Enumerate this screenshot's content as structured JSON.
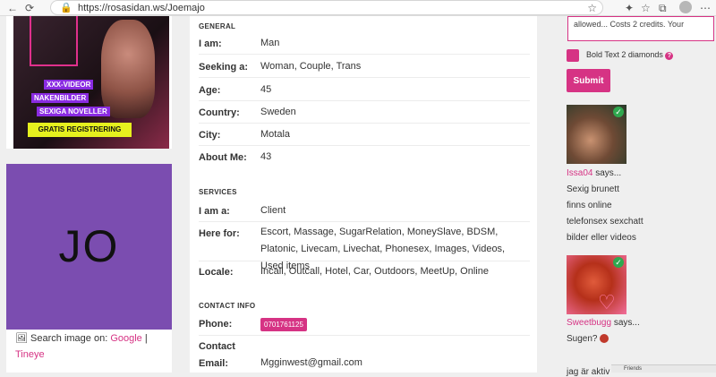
{
  "browser": {
    "url": "https://rosasidan.ws/Joemajo"
  },
  "left": {
    "ad": {
      "tags": [
        "XXX-VIDEOR",
        "NAKENBILDER",
        "SEXIGA NOVELLER"
      ],
      "cta": "GRATIS REGISTRERING"
    },
    "profile_initials": "JO",
    "search_prefix": "Search image on:",
    "search_google": "Google",
    "search_sep": "|",
    "search_tineye": "Tineye"
  },
  "general": {
    "heading": "GENERAL",
    "rows": [
      {
        "label": "I am:",
        "value": "Man"
      },
      {
        "label": "Seeking a:",
        "value": "Woman, Couple, Trans"
      },
      {
        "label": "Age:",
        "value": "45"
      },
      {
        "label": "Country:",
        "value": "Sweden"
      },
      {
        "label": "City:",
        "value": "Motala"
      },
      {
        "label": "About Me:",
        "value": "43"
      }
    ]
  },
  "services": {
    "heading": "SERVICES",
    "rows": [
      {
        "label": "I am a:",
        "value": "Client"
      },
      {
        "label": "Here for:",
        "value": "Escort, Massage, SugarRelation, MoneySlave, BDSM, Platonic, Livecam, Livechat, Phonesex, Images, Videos, Used items"
      },
      {
        "label": "Locale:",
        "value": "Incall, Outcall, Hotel, Car, Outdoors, MeetUp, Online"
      }
    ]
  },
  "contact": {
    "heading": "CONTACT INFO",
    "phone_label": "Phone:",
    "phone_value": "0701761125",
    "email_label_1": "Contact",
    "email_label_2": "Email:",
    "email_value": "Mgginwest@gmail.com"
  },
  "right": {
    "textarea_text": "allowed... Costs 2 credits. Your",
    "bold_text_label": "Bold Text 2 diamonds",
    "help_symbol": "?",
    "submit_label": "Submit",
    "posts": [
      {
        "user": "Issa04",
        "says": "says...",
        "lines": [
          "Sexig brunett",
          "finns online",
          "telefonsex sexchatt",
          "bilder eller videos"
        ]
      },
      {
        "user": "Sweetbugg",
        "says": "says...",
        "lines": [
          "Sugen?"
        ]
      }
    ],
    "partial_line": "jag är aktiv"
  },
  "taskbar_mini": "Friends"
}
